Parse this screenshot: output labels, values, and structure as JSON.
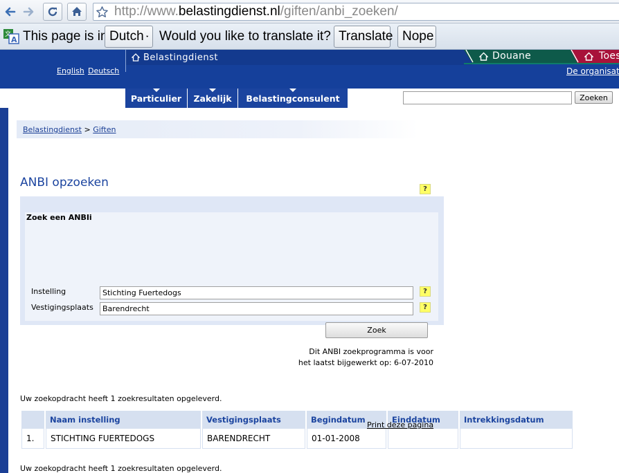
{
  "browser": {
    "url_prefix": "http://www.",
    "url_host": "belastingdienst.nl",
    "url_path": "/giften/anbi_zoeken/"
  },
  "translate_bar": {
    "message_start": "This page is in",
    "language": "Dutch",
    "question": "Would you like to translate it?",
    "translate_label": "Translate",
    "nope_label": "Nope"
  },
  "header": {
    "brand": "Belastingdienst",
    "lang_english": "English",
    "lang_deutsch": "Deutsch",
    "tab_douane": "Douane",
    "tab_toeslagen": "Toes",
    "org_link": "De organisati"
  },
  "main_nav": {
    "tabs": [
      "Particulier",
      "Zakelijk",
      "Belastingconsulent"
    ],
    "search_button": "Zoeken"
  },
  "breadcrumb": {
    "root": "Belastingdienst",
    "separator": ">",
    "current": "Giften"
  },
  "page": {
    "title": "ANBI opzoeken",
    "help_symbol": "?"
  },
  "search_form": {
    "heading": "Zoek een ANBIi",
    "instelling_label": "Instelling",
    "instelling_value": "Stichting Fuertedogs",
    "vestiging_label": "Vestigingsplaats",
    "vestiging_value": "Barendrecht",
    "zoek_button": "Zoek",
    "note_line1": "Dit ANBI zoekprogramma is voor",
    "note_line2": "het laatst bijgewerkt op: 6-07-2010"
  },
  "results": {
    "summary_top": "Uw zoekopdracht heeft 1 zoekresultaten opgeleverd.",
    "summary_bottom": "Uw zoekopdracht heeft 1 zoekresultaten opgeleverd.",
    "columns": [
      "",
      "Naam instelling",
      "Vestigingsplaats",
      "Begindatum",
      "Einddatum",
      "Intrekkingsdatum"
    ],
    "rows": [
      [
        "1.",
        "STICHTING FUERTEDOGS",
        "BARENDRECHT",
        "01-01-2008",
        "",
        ""
      ]
    ],
    "print_link": "Print deze pagina"
  },
  "colors": {
    "header_blue": "#15409b",
    "tab_green": "#0e5a4a",
    "tab_red": "#a8123a",
    "help_yellow": "#ffff66",
    "panel_blue": "#dfe7f6"
  }
}
